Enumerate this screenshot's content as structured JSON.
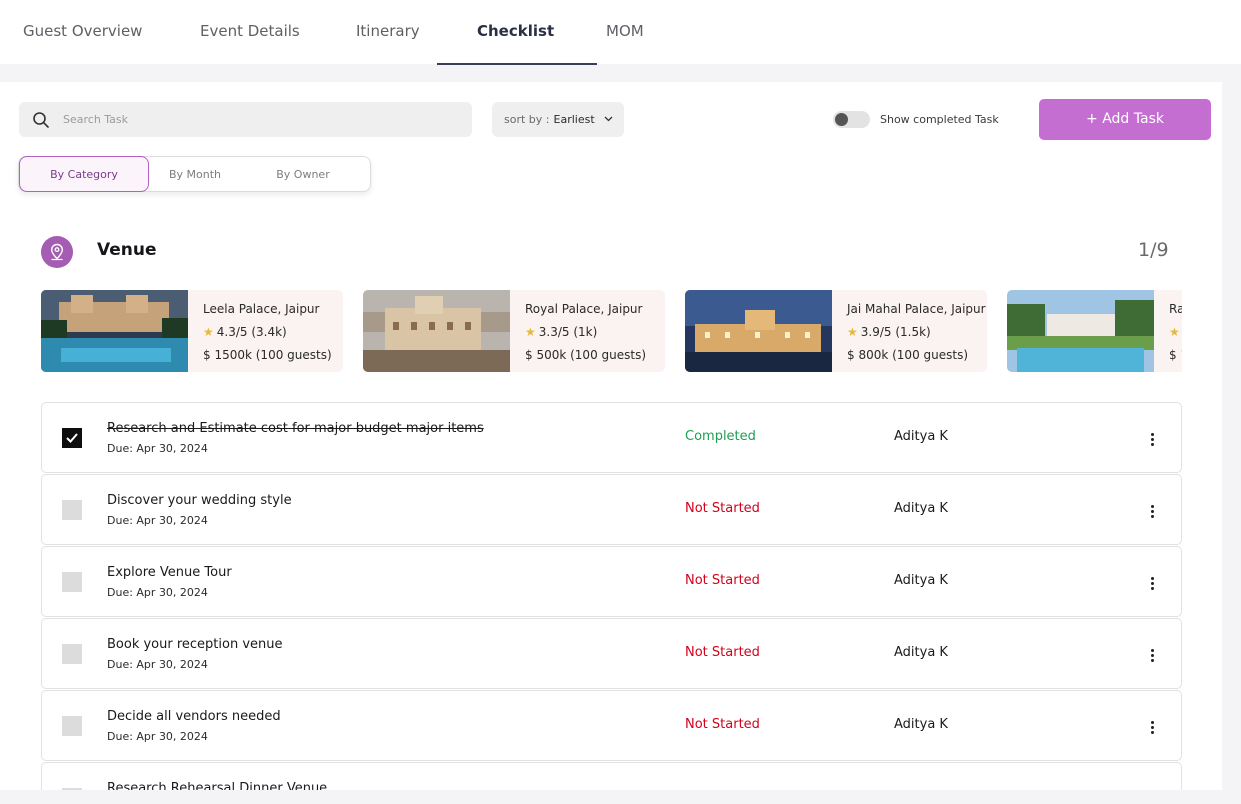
{
  "tabs": [
    {
      "label": "Guest Overview"
    },
    {
      "label": "Event Details"
    },
    {
      "label": "Itinerary"
    },
    {
      "label": "Checklist"
    },
    {
      "label": "MOM"
    }
  ],
  "active_tab": "Checklist",
  "toolbar": {
    "search_placeholder": "Search Task",
    "sort_label": "sort by :",
    "sort_value": "Earliest",
    "show_completed_label": "Show completed Task",
    "show_completed_on": false,
    "add_task_label": "+ Add Task"
  },
  "view_switch": [
    {
      "label": "By Category"
    },
    {
      "label": "By Month"
    },
    {
      "label": "By Owner"
    }
  ],
  "active_view": "By Category",
  "category": {
    "title": "Venue",
    "count": "1/9",
    "icon": "location-pin-icon"
  },
  "venues": [
    {
      "name": "Leela Palace, Jaipur",
      "rating": "4.3/5 (3.4k)",
      "price": "$ 1500k (100 guests)"
    },
    {
      "name": "Royal Palace, Jaipur",
      "rating": "3.3/5 (1k)",
      "price": "$ 500k (100 guests)"
    },
    {
      "name": "Jai Mahal Palace, Jaipur",
      "rating": "3.9/5 (1.5k)",
      "price": "$ 800k (100 guests)"
    },
    {
      "name": "Ra",
      "rating": "",
      "price": "$ 1"
    }
  ],
  "tasks": [
    {
      "title": "Research and Estimate cost for major budget major items",
      "due": "Due: Apr 30, 2024",
      "status": "Completed",
      "owner": "Aditya K",
      "checked": true
    },
    {
      "title": "Discover your wedding style",
      "due": "Due: Apr 30, 2024",
      "status": "Not Started",
      "owner": "Aditya K",
      "checked": false
    },
    {
      "title": "Explore Venue Tour",
      "due": "Due: Apr 30, 2024",
      "status": "Not Started",
      "owner": "Aditya K",
      "checked": false
    },
    {
      "title": "Book your reception venue",
      "due": "Due: Apr 30, 2024",
      "status": "Not Started",
      "owner": "Aditya K",
      "checked": false
    },
    {
      "title": "Decide all vendors needed",
      "due": "Due: Apr 30, 2024",
      "status": "Not Started",
      "owner": "Aditya K",
      "checked": false
    },
    {
      "title": "Research Rehearsal Dinner Venue",
      "due": "",
      "status": "",
      "owner": "",
      "checked": false
    }
  ],
  "colors": {
    "accent": "#c56ed2",
    "completed": "#1f9d55",
    "not_started": "#d0021b"
  }
}
